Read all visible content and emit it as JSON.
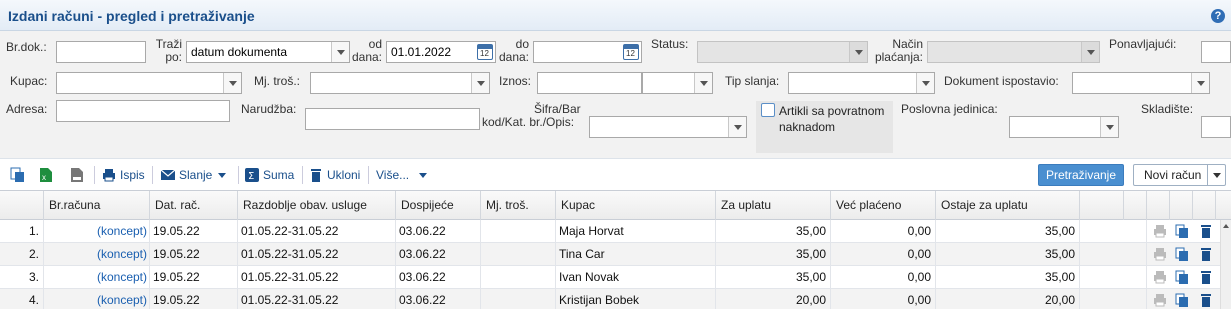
{
  "header": {
    "title": "Izdani računi - pregled i pretraživanje",
    "help_icon": "question-circle-icon",
    "help_glyph": "?"
  },
  "filters": {
    "br_dok": {
      "label": "Br.dok.:",
      "value": ""
    },
    "trazi_po": {
      "label_line1": "Traži",
      "label_line2": "po:",
      "value": "datum dokumenta"
    },
    "od_dana": {
      "label_line1": "od",
      "label_line2": "dana:",
      "value": "01.01.2022"
    },
    "do_dana": {
      "label_line1": "do",
      "label_line2": "dana:",
      "value": ""
    },
    "status": {
      "label": "Status:",
      "value": ""
    },
    "nacin_placanja": {
      "label_line1": "Način",
      "label_line2": "plaćanja:",
      "value": ""
    },
    "ponavljajuci": {
      "label": "Ponavljajući:",
      "value": ""
    },
    "kupac": {
      "label": "Kupac:",
      "value": ""
    },
    "mj_tros": {
      "label": "Mj. troš.:",
      "value": ""
    },
    "iznos": {
      "label": "Iznos:",
      "value_from": "",
      "value_to": ""
    },
    "tip_slanja": {
      "label": "Tip slanja:",
      "value": ""
    },
    "dokument_ispostavio": {
      "label": "Dokument ispostavio:",
      "value": ""
    },
    "adresa": {
      "label": "Adresa:",
      "value": ""
    },
    "narudzba": {
      "label": "Narudžba:",
      "value": ""
    },
    "sifra_bar": {
      "label_line1": "Šifra/Bar",
      "label_line2": "kod/Kat. br./Opis:",
      "value": ""
    },
    "artikli_povratna": {
      "label": "Artikli sa povratnom naknadom",
      "checked": false
    },
    "poslovna_jedinica": {
      "label": "Poslovna jedinica:",
      "value": ""
    },
    "skladiste": {
      "label": "Skladište:",
      "value": ""
    }
  },
  "toolbar": {
    "ispis": "Ispis",
    "slanje": "Slanje",
    "suma": "Suma",
    "ukloni": "Ukloni",
    "vise": "Više...",
    "pretrazivanje": "Pretraživanje",
    "novi_racun": "Novi račun",
    "icons": [
      "copy-icon",
      "excel-icon",
      "csv-icon",
      "printer-icon",
      "envelope-icon",
      "sum-icon",
      "trash-icon"
    ]
  },
  "table": {
    "columns": [
      "Br.računa",
      "Dat. rač.",
      "Razdoblje obav. usluge",
      "Dospijeće",
      "Mj. troš.",
      "Kupac",
      "Za uplatu",
      "Već plaćeno",
      "Ostaje za uplatu"
    ],
    "rows": [
      {
        "no": "1.",
        "br": "(koncept)",
        "dat": "19.05.22",
        "razdoblje": "01.05.22-31.05.22",
        "dospijece": "03.06.22",
        "mj": "",
        "kupac": "Maja Horvat",
        "za_uplatu": "35,00",
        "placeno": "0,00",
        "ostaje": "35,00"
      },
      {
        "no": "2.",
        "br": "(koncept)",
        "dat": "19.05.22",
        "razdoblje": "01.05.22-31.05.22",
        "dospijece": "03.06.22",
        "mj": "",
        "kupac": "Tina Car",
        "za_uplatu": "35,00",
        "placeno": "0,00",
        "ostaje": "35,00"
      },
      {
        "no": "3.",
        "br": "(koncept)",
        "dat": "19.05.22",
        "razdoblje": "01.05.22-31.05.22",
        "dospijece": "03.06.22",
        "mj": "",
        "kupac": "Ivan Novak",
        "za_uplatu": "35,00",
        "placeno": "0,00",
        "ostaje": "35,00"
      },
      {
        "no": "4.",
        "br": "(koncept)",
        "dat": "19.05.22",
        "razdoblje": "01.05.22-31.05.22",
        "dospijece": "03.06.22",
        "mj": "",
        "kupac": "Kristijan Bobek",
        "za_uplatu": "20,00",
        "placeno": "0,00",
        "ostaje": "20,00"
      }
    ],
    "row_icons": [
      "print-icon",
      "copy-icon",
      "delete-icon"
    ]
  },
  "colors": {
    "accent": "#1a4f8b",
    "button": "#4a8fd0",
    "link": "#1a5fb0"
  }
}
